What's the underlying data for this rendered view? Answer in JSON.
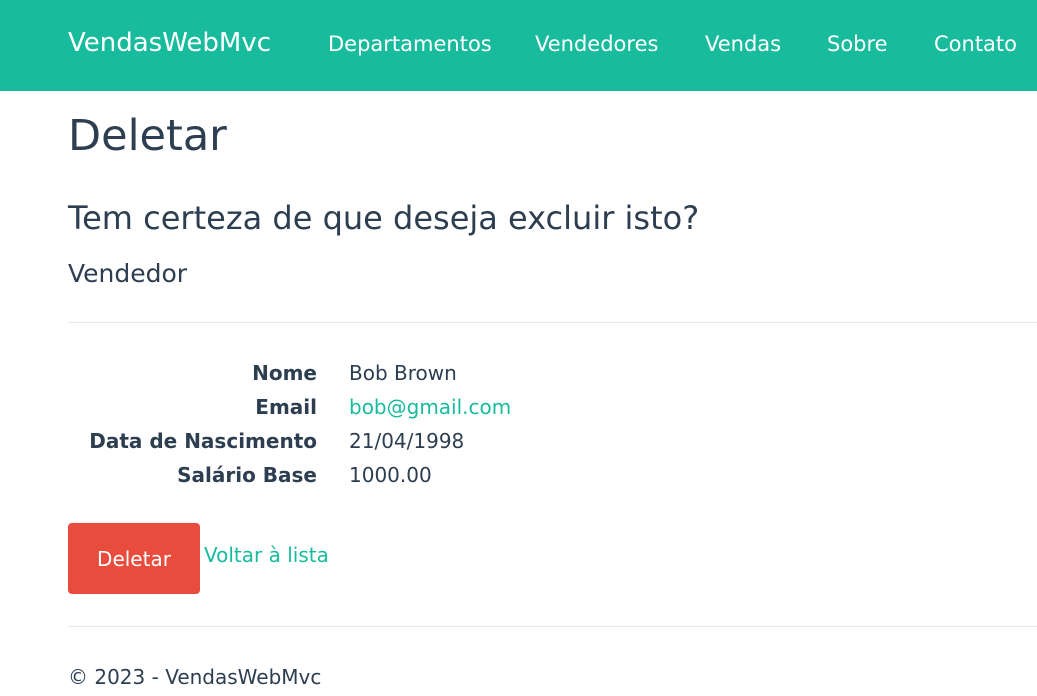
{
  "navbar": {
    "brand": "VendasWebMvc",
    "links": [
      "Departamentos",
      "Vendedores",
      "Vendas",
      "Sobre",
      "Contato"
    ]
  },
  "page": {
    "title": "Deletar",
    "question": "Tem certeza de que deseja excluir isto?",
    "entity": "Vendedor"
  },
  "details": [
    {
      "label": "Nome",
      "value": "Bob Brown"
    },
    {
      "label": "Email",
      "value": "bob@gmail.com"
    },
    {
      "label": "Data de Nascimento",
      "value": "21/04/1998"
    },
    {
      "label": "Salário Base",
      "value": "1000.00"
    }
  ],
  "actions": {
    "delete_label": "Deletar",
    "back_label": "Voltar à lista"
  },
  "footer": {
    "text": "© 2023 - VendasWebMvc"
  },
  "colors": {
    "navbar": "#18bc9c",
    "text": "#2c3e50",
    "link": "#18bc9c",
    "danger": "#e74c3c"
  }
}
